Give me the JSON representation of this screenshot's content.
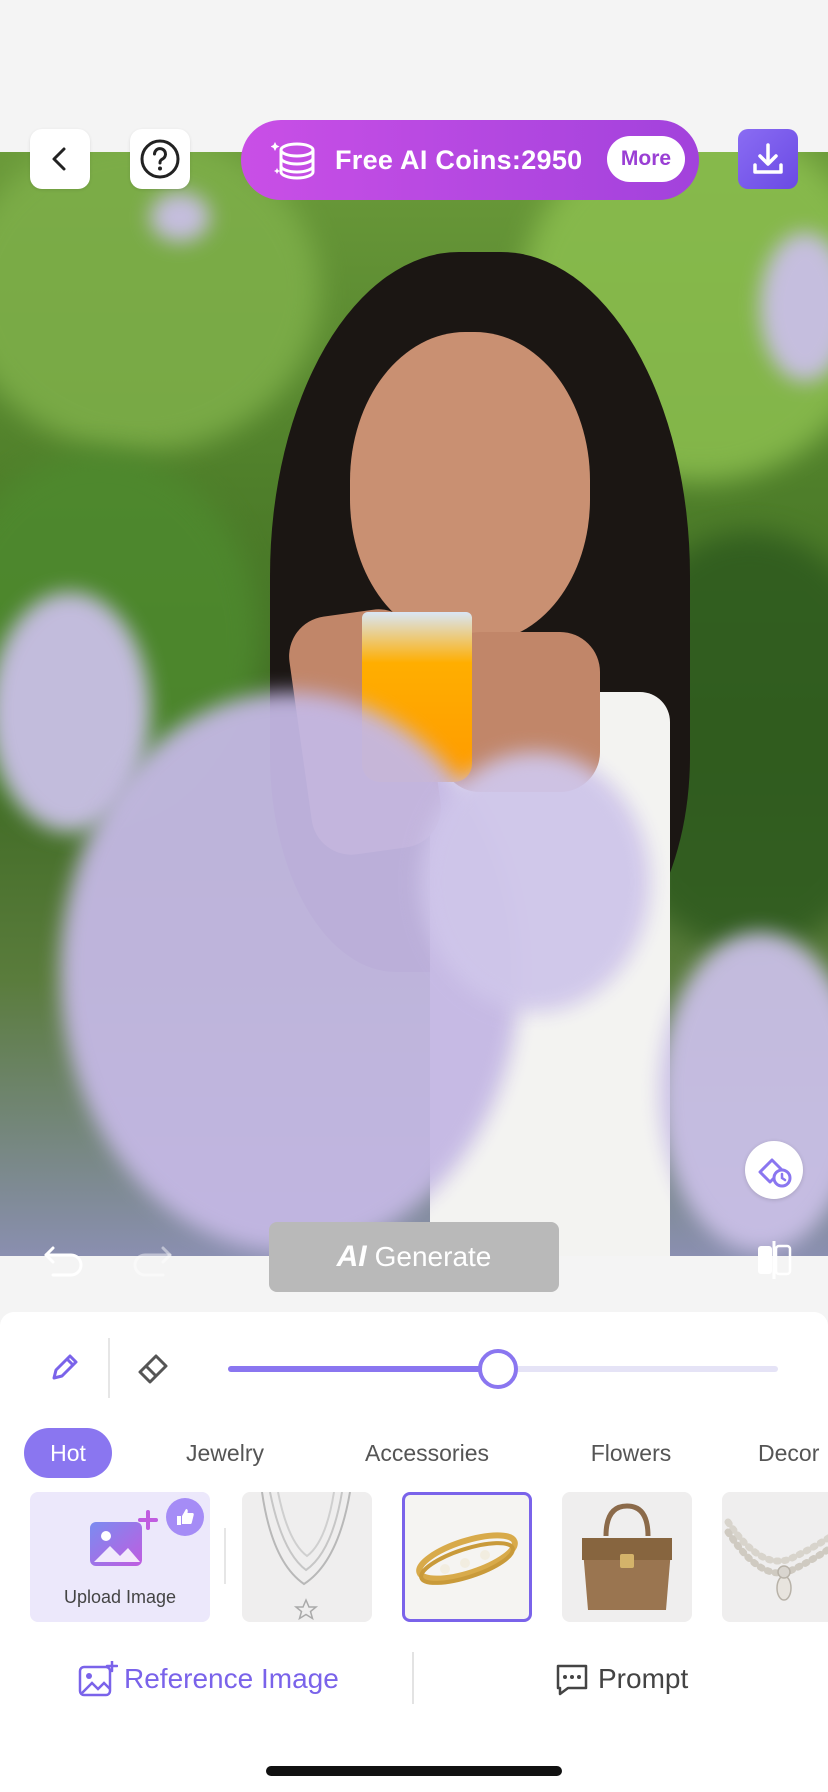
{
  "header": {
    "coins_label": "Free AI Coins:2950",
    "more_label": "More"
  },
  "canvas": {
    "generate_label": "Generate",
    "generate_ai_label": "AI"
  },
  "brush": {
    "size_fraction": 0.49
  },
  "tabs": [
    {
      "label": "Hot",
      "active": true
    },
    {
      "label": "Jewelry",
      "active": false
    },
    {
      "label": "Accessories",
      "active": false
    },
    {
      "label": "Flowers",
      "active": false
    },
    {
      "label": "Decor",
      "active": false
    }
  ],
  "items": {
    "upload_label": "Upload Image",
    "thumbnails": [
      "necklace",
      "bracelet",
      "handbag",
      "pearl-necklace"
    ],
    "selected_index": 1
  },
  "bottom": {
    "reference_label": "Reference Image",
    "prompt_label": "Prompt"
  },
  "colors": {
    "accent": "#8a76f0",
    "coins_gradient_start": "#c94fe6",
    "coins_gradient_end": "#a242dc",
    "generate_disabled": "#b9b9b9"
  }
}
